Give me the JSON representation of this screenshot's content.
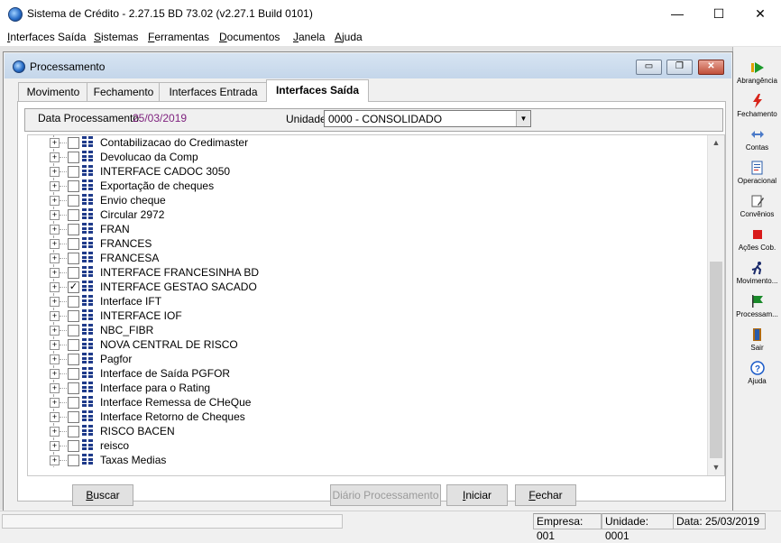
{
  "window": {
    "title": "Sistema de Crédito - 2.27.15 BD 73.02 (v2.27.1 Build 0101)",
    "controls": {
      "minimize": "—",
      "maximize": "☐",
      "close": "✕"
    }
  },
  "menubar": [
    {
      "label": "Interfaces Saída",
      "accel": "I",
      "rest": "nterfaces Saída"
    },
    {
      "label": "Sistemas",
      "accel": "S",
      "rest": "istemas"
    },
    {
      "label": "Ferramentas",
      "accel": "F",
      "rest": "erramentas"
    },
    {
      "label": "Documentos",
      "accel": "D",
      "rest": "ocumentos"
    },
    {
      "label": "Janela",
      "accel": "J",
      "rest": "anela"
    },
    {
      "label": "Ajuda",
      "accel": "A",
      "rest": "juda"
    }
  ],
  "child_window": {
    "title": "Processamento",
    "controls": {
      "minimize": "▭",
      "restore": "❐",
      "close": "✕"
    }
  },
  "tabs": [
    {
      "label": "Movimento",
      "active": false
    },
    {
      "label": "Fechamento",
      "active": false
    },
    {
      "label": "Interfaces Entrada",
      "active": false
    },
    {
      "label": "Interfaces Saída",
      "active": true
    }
  ],
  "header": {
    "date_label": "Data Processamento",
    "date_value": "25/03/2019",
    "unit_label": "Unidade",
    "unit_value": "0000 - CONSOLIDADO"
  },
  "tree_items": [
    {
      "label": "Contabilizacao do Credimaster",
      "checked": false
    },
    {
      "label": "Devolucao da Comp",
      "checked": false
    },
    {
      "label": "INTERFACE CADOC 3050",
      "checked": false
    },
    {
      "label": "Exportação de cheques",
      "checked": false
    },
    {
      "label": "Envio cheque",
      "checked": false
    },
    {
      "label": "Circular 2972",
      "checked": false
    },
    {
      "label": "FRAN",
      "checked": false
    },
    {
      "label": "FRANCES",
      "checked": false
    },
    {
      "label": "FRANCESA",
      "checked": false
    },
    {
      "label": "INTERFACE FRANCESINHA BD",
      "checked": false
    },
    {
      "label": "INTERFACE GESTAO SACADO",
      "checked": true
    },
    {
      "label": "Interface IFT",
      "checked": false
    },
    {
      "label": "INTERFACE IOF",
      "checked": false
    },
    {
      "label": "NBC_FIBR",
      "checked": false
    },
    {
      "label": "NOVA CENTRAL DE RISCO",
      "checked": false
    },
    {
      "label": "Pagfor",
      "checked": false
    },
    {
      "label": "Interface de Saída PGFOR",
      "checked": false
    },
    {
      "label": "Interface para o Rating",
      "checked": false
    },
    {
      "label": "Interface Remessa de CHeQue",
      "checked": false
    },
    {
      "label": "Interface Retorno de Cheques",
      "checked": false
    },
    {
      "label": "RISCO BACEN",
      "checked": false
    },
    {
      "label": "reisco",
      "checked": false
    },
    {
      "label": "Taxas Medias",
      "checked": false
    }
  ],
  "buttons": {
    "buscar": {
      "accel": "B",
      "rest": "uscar"
    },
    "diario": "Diário Processamento",
    "iniciar": {
      "accel": "I",
      "rest": "niciar"
    },
    "fechar": {
      "accel": "F",
      "rest": "echar"
    }
  },
  "toolbar": [
    {
      "label": "Abrangência",
      "icon": "arrow-right-icon",
      "color": "#1a9a2a"
    },
    {
      "label": "Fechamento",
      "icon": "lightning-icon",
      "color": "#d8241a"
    },
    {
      "label": "Contas",
      "icon": "arrows-icon",
      "color": "#4a7ac8"
    },
    {
      "label": "Operacional",
      "icon": "document-icon",
      "color": "#2a5caa"
    },
    {
      "label": "Convênios",
      "icon": "edit-icon",
      "color": "#555555"
    },
    {
      "label": "Ações Cob.",
      "icon": "stop-icon",
      "color": "#d81a1a"
    },
    {
      "label": "Movimento...",
      "icon": "runner-icon",
      "color": "#1a2a6a"
    },
    {
      "label": "Processam...",
      "icon": "flag-icon",
      "color": "#1a8a2a"
    },
    {
      "label": "Sair",
      "icon": "exit-door-icon",
      "color": "#b06a10"
    },
    {
      "label": "Ajuda",
      "icon": "help-icon",
      "color": "#1a5ac8"
    }
  ],
  "status": {
    "empresa": "Empresa: 001",
    "unidade": "Unidade: 0001",
    "data": "Data:  25/03/2019"
  }
}
